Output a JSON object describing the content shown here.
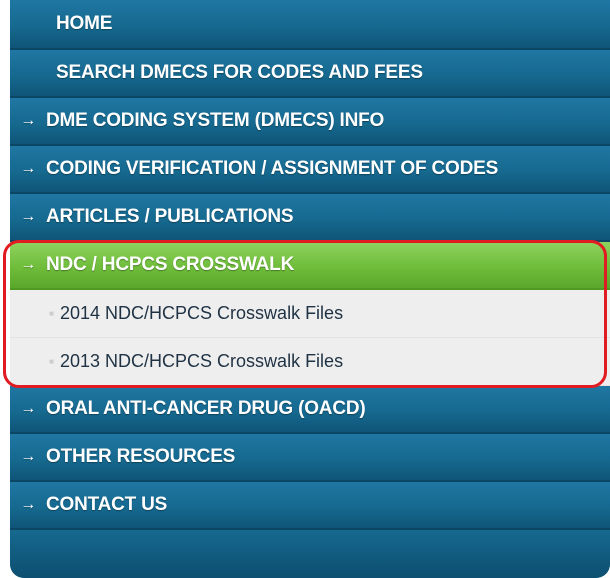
{
  "menu": {
    "home": "HOME",
    "search": "SEARCH DMECS FOR CODES AND FEES",
    "items": [
      {
        "label": "DME CODING SYSTEM (DMECS) INFO"
      },
      {
        "label": "CODING VERIFICATION / ASSIGNMENT OF CODES"
      },
      {
        "label": "ARTICLES / PUBLICATIONS"
      }
    ],
    "active": {
      "label": "NDC / HCPCS CROSSWALK"
    },
    "sub_items": [
      {
        "label": "2014 NDC/HCPCS Crosswalk Files"
      },
      {
        "label": "2013 NDC/HCPCS Crosswalk Files"
      }
    ],
    "items_after": [
      {
        "label": "ORAL ANTI-CANCER DRUG (OACD)"
      },
      {
        "label": "OTHER RESOURCES"
      },
      {
        "label": "CONTACT US"
      }
    ],
    "arrow_glyph": "→",
    "bullet_glyph": "■"
  },
  "colors": {
    "nav_blue": "#1f77a3",
    "active_green": "#6fbd3b",
    "highlight_red": "#e11b22",
    "sub_bg": "#eeeeee"
  }
}
